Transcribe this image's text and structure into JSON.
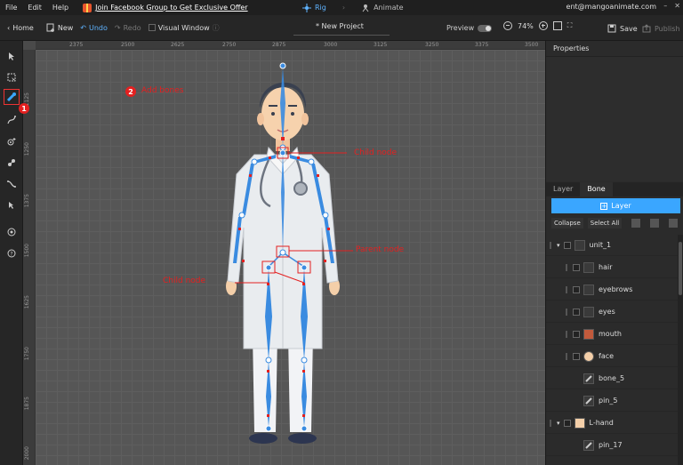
{
  "menu": {
    "items": [
      "File",
      "Edit",
      "Help"
    ],
    "promo": "Join Facebook Group to Get Exclusive Offer",
    "modes": [
      {
        "label": "Rig",
        "active": true
      },
      {
        "label": "Animate",
        "active": false
      }
    ],
    "email": "ent@mangoanimate.com"
  },
  "toolbar": {
    "home": "Home",
    "new": "New",
    "undo": "Undo",
    "redo": "Redo",
    "visual_window": "Visual Window",
    "project": "* New Project",
    "preview": "Preview",
    "zoom": "74%",
    "save": "Save",
    "publish": "Publish"
  },
  "ruler": {
    "top": [
      "2375",
      "2500",
      "2625",
      "2750",
      "2875",
      "3000",
      "3125",
      "3250",
      "3375",
      "3500"
    ],
    "left": [
      "1125",
      "1250",
      "1375",
      "1500",
      "1625",
      "1750",
      "1875",
      "2000"
    ]
  },
  "annotations": {
    "step1": "1",
    "step2": "2",
    "add_bones": "Add bones",
    "child_node_top": "Child node",
    "parent_node": "Parent node",
    "child_node_left": "Child node"
  },
  "panel": {
    "properties": "Properties",
    "tabs": [
      {
        "label": "Layer",
        "active": false
      },
      {
        "label": "Bone",
        "active": true
      }
    ],
    "layer_button": "Layer",
    "collapse": "Collapse",
    "select_all": "Select All",
    "layers": [
      {
        "name": "unit_1",
        "level": 0,
        "expand": true
      },
      {
        "name": "hair",
        "level": 1
      },
      {
        "name": "eyebrows",
        "level": 1
      },
      {
        "name": "eyes",
        "level": 1
      },
      {
        "name": "mouth",
        "level": 1
      },
      {
        "name": "face",
        "level": 1
      },
      {
        "name": "bone_5",
        "level": 2
      },
      {
        "name": "pin_5",
        "level": 2
      },
      {
        "name": "L-hand",
        "level": 0,
        "expand": true
      },
      {
        "name": "pin_17",
        "level": 2
      }
    ]
  },
  "colors": {
    "accent": "#3aa6ff",
    "annotation": "#e42020"
  }
}
